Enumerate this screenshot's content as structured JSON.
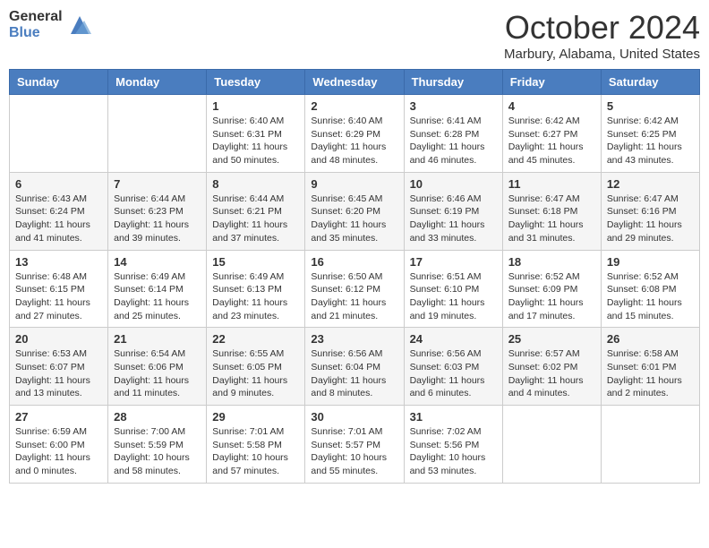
{
  "header": {
    "logo_general": "General",
    "logo_blue": "Blue",
    "month_title": "October 2024",
    "location": "Marbury, Alabama, United States"
  },
  "days_of_week": [
    "Sunday",
    "Monday",
    "Tuesday",
    "Wednesday",
    "Thursday",
    "Friday",
    "Saturday"
  ],
  "weeks": [
    [
      {
        "day": "",
        "info": ""
      },
      {
        "day": "",
        "info": ""
      },
      {
        "day": "1",
        "info": "Sunrise: 6:40 AM\nSunset: 6:31 PM\nDaylight: 11 hours and 50 minutes."
      },
      {
        "day": "2",
        "info": "Sunrise: 6:40 AM\nSunset: 6:29 PM\nDaylight: 11 hours and 48 minutes."
      },
      {
        "day": "3",
        "info": "Sunrise: 6:41 AM\nSunset: 6:28 PM\nDaylight: 11 hours and 46 minutes."
      },
      {
        "day": "4",
        "info": "Sunrise: 6:42 AM\nSunset: 6:27 PM\nDaylight: 11 hours and 45 minutes."
      },
      {
        "day": "5",
        "info": "Sunrise: 6:42 AM\nSunset: 6:25 PM\nDaylight: 11 hours and 43 minutes."
      }
    ],
    [
      {
        "day": "6",
        "info": "Sunrise: 6:43 AM\nSunset: 6:24 PM\nDaylight: 11 hours and 41 minutes."
      },
      {
        "day": "7",
        "info": "Sunrise: 6:44 AM\nSunset: 6:23 PM\nDaylight: 11 hours and 39 minutes."
      },
      {
        "day": "8",
        "info": "Sunrise: 6:44 AM\nSunset: 6:21 PM\nDaylight: 11 hours and 37 minutes."
      },
      {
        "day": "9",
        "info": "Sunrise: 6:45 AM\nSunset: 6:20 PM\nDaylight: 11 hours and 35 minutes."
      },
      {
        "day": "10",
        "info": "Sunrise: 6:46 AM\nSunset: 6:19 PM\nDaylight: 11 hours and 33 minutes."
      },
      {
        "day": "11",
        "info": "Sunrise: 6:47 AM\nSunset: 6:18 PM\nDaylight: 11 hours and 31 minutes."
      },
      {
        "day": "12",
        "info": "Sunrise: 6:47 AM\nSunset: 6:16 PM\nDaylight: 11 hours and 29 minutes."
      }
    ],
    [
      {
        "day": "13",
        "info": "Sunrise: 6:48 AM\nSunset: 6:15 PM\nDaylight: 11 hours and 27 minutes."
      },
      {
        "day": "14",
        "info": "Sunrise: 6:49 AM\nSunset: 6:14 PM\nDaylight: 11 hours and 25 minutes."
      },
      {
        "day": "15",
        "info": "Sunrise: 6:49 AM\nSunset: 6:13 PM\nDaylight: 11 hours and 23 minutes."
      },
      {
        "day": "16",
        "info": "Sunrise: 6:50 AM\nSunset: 6:12 PM\nDaylight: 11 hours and 21 minutes."
      },
      {
        "day": "17",
        "info": "Sunrise: 6:51 AM\nSunset: 6:10 PM\nDaylight: 11 hours and 19 minutes."
      },
      {
        "day": "18",
        "info": "Sunrise: 6:52 AM\nSunset: 6:09 PM\nDaylight: 11 hours and 17 minutes."
      },
      {
        "day": "19",
        "info": "Sunrise: 6:52 AM\nSunset: 6:08 PM\nDaylight: 11 hours and 15 minutes."
      }
    ],
    [
      {
        "day": "20",
        "info": "Sunrise: 6:53 AM\nSunset: 6:07 PM\nDaylight: 11 hours and 13 minutes."
      },
      {
        "day": "21",
        "info": "Sunrise: 6:54 AM\nSunset: 6:06 PM\nDaylight: 11 hours and 11 minutes."
      },
      {
        "day": "22",
        "info": "Sunrise: 6:55 AM\nSunset: 6:05 PM\nDaylight: 11 hours and 9 minutes."
      },
      {
        "day": "23",
        "info": "Sunrise: 6:56 AM\nSunset: 6:04 PM\nDaylight: 11 hours and 8 minutes."
      },
      {
        "day": "24",
        "info": "Sunrise: 6:56 AM\nSunset: 6:03 PM\nDaylight: 11 hours and 6 minutes."
      },
      {
        "day": "25",
        "info": "Sunrise: 6:57 AM\nSunset: 6:02 PM\nDaylight: 11 hours and 4 minutes."
      },
      {
        "day": "26",
        "info": "Sunrise: 6:58 AM\nSunset: 6:01 PM\nDaylight: 11 hours and 2 minutes."
      }
    ],
    [
      {
        "day": "27",
        "info": "Sunrise: 6:59 AM\nSunset: 6:00 PM\nDaylight: 11 hours and 0 minutes."
      },
      {
        "day": "28",
        "info": "Sunrise: 7:00 AM\nSunset: 5:59 PM\nDaylight: 10 hours and 58 minutes."
      },
      {
        "day": "29",
        "info": "Sunrise: 7:01 AM\nSunset: 5:58 PM\nDaylight: 10 hours and 57 minutes."
      },
      {
        "day": "30",
        "info": "Sunrise: 7:01 AM\nSunset: 5:57 PM\nDaylight: 10 hours and 55 minutes."
      },
      {
        "day": "31",
        "info": "Sunrise: 7:02 AM\nSunset: 5:56 PM\nDaylight: 10 hours and 53 minutes."
      },
      {
        "day": "",
        "info": ""
      },
      {
        "day": "",
        "info": ""
      }
    ]
  ]
}
